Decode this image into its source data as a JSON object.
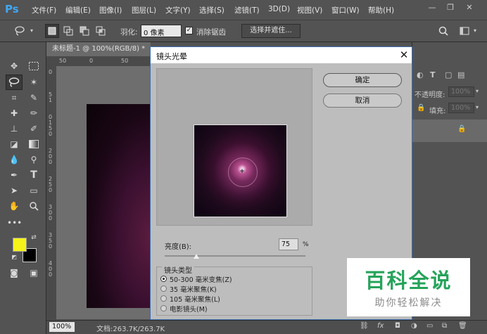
{
  "app": {
    "logo": "Ps"
  },
  "menu": {
    "items": [
      "文件(F)",
      "编辑(E)",
      "图像(I)",
      "图层(L)",
      "文字(Y)",
      "选择(S)",
      "滤镜(T)",
      "3D(D)",
      "视图(V)",
      "窗口(W)",
      "帮助(H)"
    ]
  },
  "window_controls": {
    "minimize": "—",
    "restore": "❐",
    "close": "✕"
  },
  "options_bar": {
    "feather_label": "羽化:",
    "feather_value": "0 像素",
    "antialias_label": "消除锯齿",
    "antialias_checked": "✓",
    "select_mask_label": "选择并遮住..."
  },
  "document": {
    "tab_title": "未标题-1 @ 100%(RGB/8) *",
    "ruler_h_ticks": [
      "50",
      "0",
      "50"
    ],
    "ruler_v_ticks": [
      "0",
      "5",
      "1",
      "0",
      "1",
      "5",
      "0",
      "2",
      "0",
      "0",
      "2",
      "5",
      "0",
      "3",
      "0",
      "0",
      "3",
      "5",
      "0",
      "4",
      "0",
      "0"
    ]
  },
  "status_bar": {
    "zoom": "100%",
    "doc_size": "文档:263.7K/263.7K"
  },
  "right_panel": {
    "opacity_label": "不透明度:",
    "opacity_value": "100%",
    "fill_label": "填充:",
    "fill_value": "100%"
  },
  "dialog": {
    "title": "镜头光晕",
    "ok_label": "确定",
    "cancel_label": "取消",
    "brightness_label": "亮度(B):",
    "brightness_value": "75",
    "brightness_unit": "%",
    "brightness_level_percent": 75,
    "lens_type_label": "镜头类型",
    "lens_options": [
      {
        "label": "50-300 毫米变焦(Z)",
        "selected": true
      },
      {
        "label": "35 毫米聚焦(K)",
        "selected": false
      },
      {
        "label": "105 毫米聚焦(L)",
        "selected": false
      },
      {
        "label": "电影镜头(M)",
        "selected": false
      }
    ]
  },
  "watermark": {
    "main": "百科全说",
    "sub": "助你轻松解决"
  },
  "colors": {
    "foreground": "#f5f21a",
    "background": "#000000",
    "dialog_border": "#3f6fae",
    "watermark_green": "#25a35a"
  }
}
